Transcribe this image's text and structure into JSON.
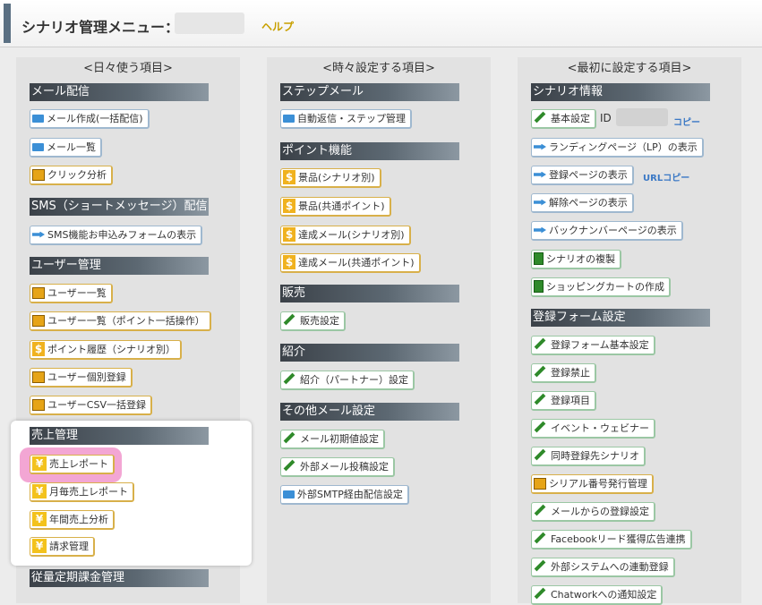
{
  "header": {
    "title": "シナリオ管理メニュー：",
    "help": "ヘルプ"
  },
  "columns": {
    "daily": {
      "title": "<日々使う項目>"
    },
    "sometimes": {
      "title": "<時々設定する項目>"
    },
    "first": {
      "title": "<最初に設定する項目>"
    }
  },
  "left": {
    "mail": {
      "header": "メール配信",
      "compose": "メール作成(一括配信)",
      "list": "メール一覧",
      "click": "クリック分析"
    },
    "sms": {
      "header": "SMS（ショートメッセージ）配信",
      "form": "SMS機能お申込みフォームの表示"
    },
    "users": {
      "header": "ユーザー管理",
      "list": "ユーザー一覧",
      "list_bulk": "ユーザー一覧（ポイント一括操作）",
      "points": "ポイント履歴（シナリオ別）",
      "register": "ユーザー個別登録",
      "csv": "ユーザーCSV一括登録"
    },
    "sales": {
      "header": "売上管理",
      "report": "売上レポート",
      "monthly": "月毎売上レポート",
      "yearly": "年間売上分析",
      "billing": "請求管理"
    },
    "subscription": {
      "header": "従量定期課金管理"
    }
  },
  "middle": {
    "step": {
      "header": "ステップメール",
      "autoreply": "自動返信・ステップ管理"
    },
    "points": {
      "header": "ポイント機能",
      "prize_scenario": "景品(シナリオ別)",
      "prize_common": "景品(共通ポイント)",
      "achieve_scenario": "達成メール(シナリオ別)",
      "achieve_common": "達成メール(共通ポイント)"
    },
    "sales": {
      "header": "販売",
      "settings": "販売設定"
    },
    "intro": {
      "header": "紹介",
      "settings": "紹介（パートナー）設定"
    },
    "other": {
      "header": "その他メール設定",
      "initial": "メール初期値設定",
      "external": "外部メール投稿設定",
      "smtp": "外部SMTP経由配信設定"
    }
  },
  "right": {
    "scenario": {
      "header": "シナリオ情報",
      "basic": "基本設定",
      "id_label": "ID",
      "copy": "コピー",
      "lp": "ランディングページ（LP）の表示",
      "register_page": "登録ページの表示",
      "url_copy": "URLコピー",
      "cancel_page": "解除ページの表示",
      "backnumber": "バックナンバーページの表示",
      "duplicate": "シナリオの複製",
      "cart": "ショッピングカートの作成"
    },
    "form": {
      "header": "登録フォーム設定",
      "basic": "登録フォーム基本設定",
      "block": "登録禁止",
      "fields": "登録項目",
      "event": "イベント・ウェビナー",
      "simultaneous": "同時登録先シナリオ",
      "serial": "シリアル番号発行管理",
      "from_mail": "メールからの登録設定",
      "facebook": "Facebookリード獲得広告連携",
      "external": "外部システムへの連動登録",
      "chatwork": "Chatworkへの通知設定"
    }
  }
}
